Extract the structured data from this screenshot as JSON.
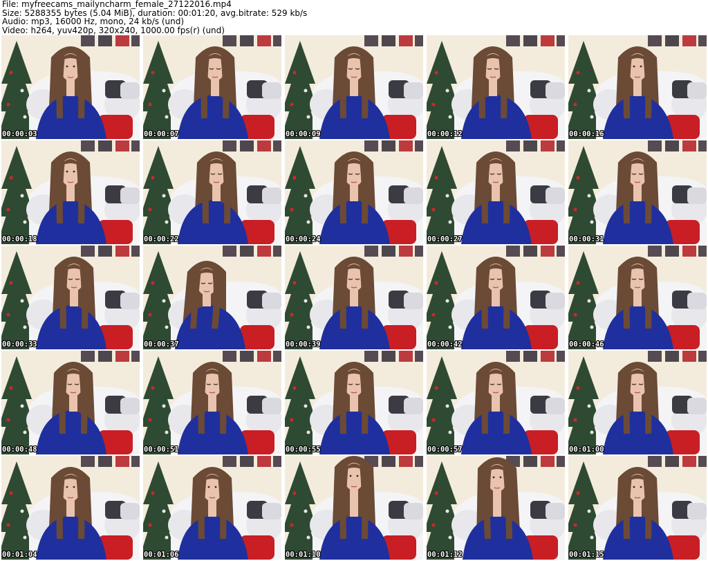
{
  "header": {
    "file_line": "File: myfreecams_mailyncharm_female_27122016.mp4",
    "size_line": "Size: 5288355 bytes (5.04 MiB), duration: 00:01:20, avg.bitrate: 529 kb/s",
    "audio_line": "Audio: mp3, 16000 Hz, mono, 24 kb/s (und)",
    "video_line": "Video: h264, yuv420p, 320x240, 1000.00 fps(r) (und)"
  },
  "colors": {
    "background": "#ffffff",
    "wall": "#f3ecdc",
    "sofa": "#f4f4f6",
    "tree": "#2f4a32",
    "dress": "#1f2f9e",
    "hair": "#6b4a36",
    "skin": "#e9c3ad",
    "chair_red": "#c81e24",
    "timestamp_text": "#ffffff"
  },
  "thumbnails": [
    {
      "time": "00:00:03",
      "pose": "smile",
      "tilt": 0
    },
    {
      "time": "00:00:07",
      "pose": "down",
      "tilt": 4
    },
    {
      "time": "00:00:09",
      "pose": "down",
      "tilt": 0
    },
    {
      "time": "00:00:12",
      "pose": "down",
      "tilt": -4
    },
    {
      "time": "00:00:16",
      "pose": "front",
      "tilt": 0
    },
    {
      "time": "00:00:18",
      "pose": "front",
      "tilt": 0
    },
    {
      "time": "00:00:22",
      "pose": "down",
      "tilt": 6
    },
    {
      "time": "00:00:24",
      "pose": "down",
      "tilt": 0
    },
    {
      "time": "00:00:27",
      "pose": "down",
      "tilt": 0
    },
    {
      "time": "00:00:31",
      "pose": "down",
      "tilt": 0
    },
    {
      "time": "00:00:33",
      "pose": "down",
      "tilt": 5
    },
    {
      "time": "00:00:37",
      "pose": "lean",
      "tilt": 10
    },
    {
      "time": "00:00:39",
      "pose": "down",
      "tilt": 0
    },
    {
      "time": "00:00:42",
      "pose": "down",
      "tilt": 0
    },
    {
      "time": "00:00:46",
      "pose": "down",
      "tilt": 0
    },
    {
      "time": "00:00:48",
      "pose": "down",
      "tilt": 4
    },
    {
      "time": "00:00:51",
      "pose": "down",
      "tilt": 0
    },
    {
      "time": "00:00:55",
      "pose": "down",
      "tilt": 0
    },
    {
      "time": "00:00:57",
      "pose": "down",
      "tilt": 0
    },
    {
      "time": "00:01:00",
      "pose": "down",
      "tilt": 0
    },
    {
      "time": "00:01:04",
      "pose": "front",
      "tilt": 0
    },
    {
      "time": "00:01:06",
      "pose": "front",
      "tilt": 0
    },
    {
      "time": "00:01:10",
      "pose": "standing",
      "tilt": 0
    },
    {
      "time": "00:01:12",
      "pose": "standing-side",
      "tilt": -6
    },
    {
      "time": "00:01:15",
      "pose": "front",
      "tilt": 0
    }
  ]
}
